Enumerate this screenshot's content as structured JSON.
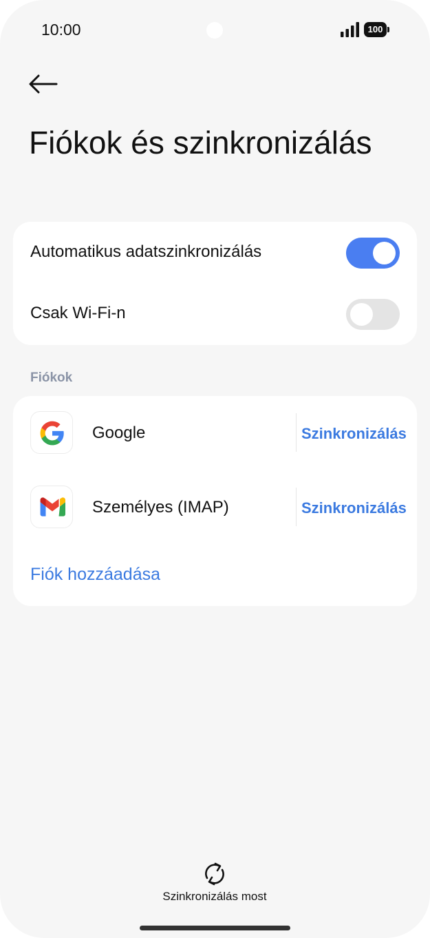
{
  "status_bar": {
    "time": "10:00",
    "battery": "100"
  },
  "header": {
    "back_icon": "arrow-left-icon",
    "title": "Fiókok és szinkronizálás"
  },
  "sync_settings": {
    "auto_sync": {
      "label": "Automatikus adatszinkronizálás",
      "enabled": true
    },
    "wifi_only": {
      "label": "Csak Wi-Fi-n",
      "enabled": false
    },
    "toggle_on_color": "#4a7ef1",
    "toggle_off_color": "#e4e4e4"
  },
  "accounts": {
    "section_title": "Fiókok",
    "items": [
      {
        "name": "Google",
        "icon": "google-icon",
        "action": "Szinkronizálás"
      },
      {
        "name": "Személyes (IMAP)",
        "icon": "gmail-icon",
        "action": "Szinkronizálás"
      }
    ],
    "add_label": "Fiók hozzáadása",
    "link_color": "#3b7ae0"
  },
  "footer": {
    "sync_now_icon": "sync-icon",
    "sync_now_label": "Szinkronizálás most"
  }
}
